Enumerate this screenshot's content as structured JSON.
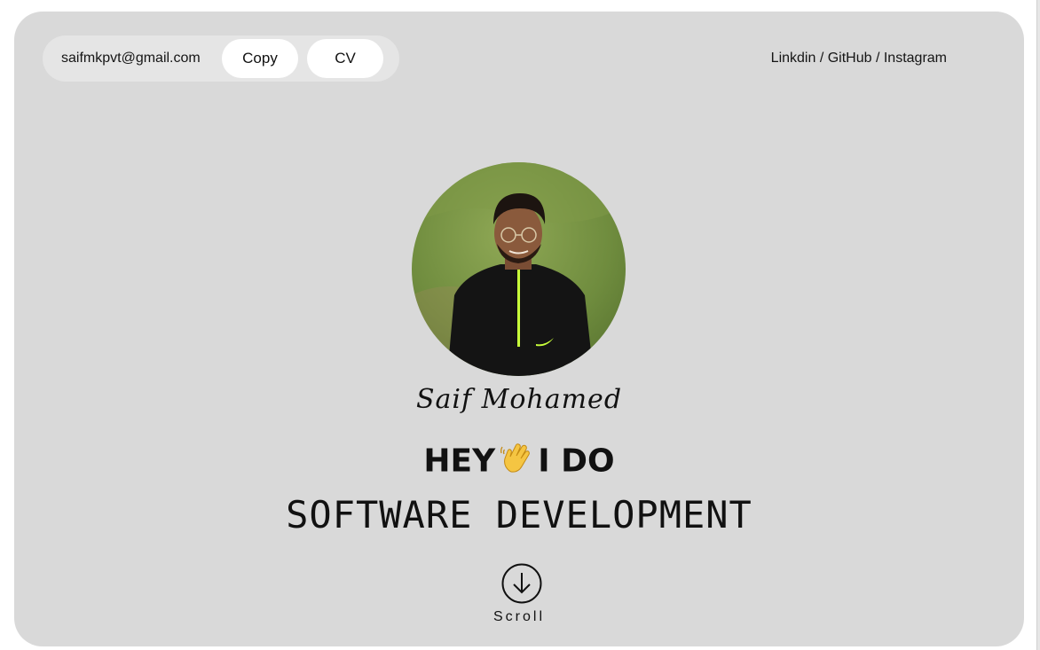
{
  "header": {
    "email": "saifmkpvt@gmail.com",
    "copy_label": "Copy",
    "cv_label": "CV",
    "social": {
      "linkedin": "Linkdin",
      "github": "GitHub",
      "instagram": "Instagram",
      "separator": " / "
    }
  },
  "hero": {
    "name": "Saif Mohamed",
    "headline_before": "HEY",
    "headline_after": "I DO",
    "wave_icon": "waving-hand-icon",
    "subheadline": "SOFTWARE DEVELOPMENT",
    "scroll_label": "Scroll",
    "scroll_icon": "arrow-down-circle-icon"
  },
  "colors": {
    "card_background": "#d9d9d9",
    "pill_background": "#e5e5e5",
    "button_background": "#ffffff",
    "text": "#111111"
  }
}
